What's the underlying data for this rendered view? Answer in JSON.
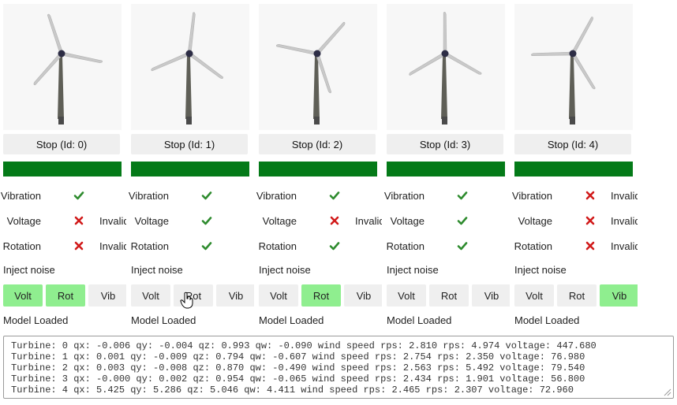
{
  "colors": {
    "ok": "#2e8b2e",
    "error": "#d11a1a",
    "status_ok": "#047a18",
    "noise_active": "#8fee8f",
    "noise_idle": "#efefef"
  },
  "labels": {
    "vibration": "Vibration",
    "voltage": "Voltage",
    "rotation": "Rotation",
    "inject_noise": "Inject noise",
    "volt_btn": "Volt",
    "rot_btn": "Rot",
    "vib_btn": "Vib",
    "invalid": "Invalid"
  },
  "turbines": [
    {
      "stop_label": "Stop (Id: 0)",
      "status": "ok",
      "vibration_ok": true,
      "voltage_ok": false,
      "rotation_ok": false,
      "vibration_msg": "",
      "voltage_msg": "Invalid",
      "rotation_msg": "Invalid",
      "noise": {
        "volt": true,
        "rot": true,
        "vib": false
      },
      "model_status": "Model Loaded",
      "rotor_angle_deg": -20
    },
    {
      "stop_label": "Stop (Id: 1)",
      "status": "ok",
      "vibration_ok": true,
      "voltage_ok": true,
      "rotation_ok": true,
      "vibration_msg": "",
      "voltage_msg": "",
      "rotation_msg": "",
      "noise": {
        "volt": false,
        "rot": false,
        "vib": false
      },
      "model_status": "Model Loaded",
      "rotor_angle_deg": 5
    },
    {
      "stop_label": "Stop (Id: 2)",
      "status": "ok",
      "vibration_ok": true,
      "voltage_ok": false,
      "rotation_ok": true,
      "vibration_msg": "",
      "voltage_msg": "Invalid",
      "rotation_msg": "",
      "noise": {
        "volt": false,
        "rot": true,
        "vib": false
      },
      "model_status": "Model Loaded",
      "rotor_angle_deg": 40
    },
    {
      "stop_label": "Stop (Id: 3)",
      "status": "ok",
      "vibration_ok": true,
      "voltage_ok": true,
      "rotation_ok": true,
      "vibration_msg": "",
      "voltage_msg": "",
      "rotation_msg": "",
      "noise": {
        "volt": false,
        "rot": false,
        "vib": false
      },
      "model_status": "Model Loaded",
      "rotor_angle_deg": -2
    },
    {
      "stop_label": "Stop (Id: 4)",
      "status": "ok",
      "vibration_ok": false,
      "voltage_ok": false,
      "rotation_ok": false,
      "vibration_msg": "Invalid",
      "voltage_msg": "Invalid",
      "rotation_msg": "Invalid",
      "noise": {
        "volt": false,
        "rot": false,
        "vib": true
      },
      "model_status": "Model Loaded",
      "rotor_angle_deg": 27
    }
  ],
  "log_lines": [
    "Turbine: 0 qx: -0.006 qy: -0.004 qz: 0.993 qw: -0.090 wind speed rps: 2.810 rps: 4.974 voltage: 447.680",
    "Turbine: 1 qx: 0.001 qy: -0.009 qz: 0.794 qw: -0.607 wind speed rps: 2.754 rps: 2.350 voltage: 76.980",
    "Turbine: 2 qx: 0.003 qy: -0.008 qz: 0.870 qw: -0.490 wind speed rps: 2.563 rps: 5.492 voltage: 79.540",
    "Turbine: 3 qx: -0.000 qy: 0.002 qz: 0.954 qw: -0.065 wind speed rps: 2.434 rps: 1.901 voltage: 56.800",
    "Turbine: 4 qx: 5.425 qy: 5.286 qz: 5.046 qw: 4.411 wind speed rps: 2.465 rps: 2.307 voltage: 72.960"
  ]
}
